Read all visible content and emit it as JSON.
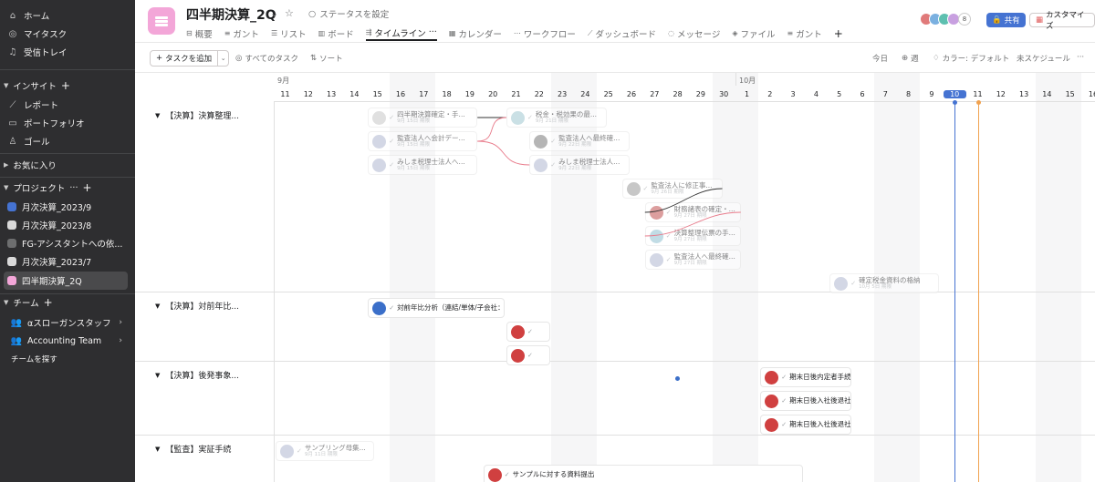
{
  "sidebar": {
    "nav": [
      {
        "label": "ホーム",
        "icon": "home-icon"
      },
      {
        "label": "マイタスク",
        "icon": "check-circle-icon"
      },
      {
        "label": "受信トレイ",
        "icon": "bell-icon"
      }
    ],
    "insight_label": "インサイト",
    "insights": [
      {
        "label": "レポート",
        "icon": "chart-line-icon"
      },
      {
        "label": "ポートフォリオ",
        "icon": "folder-icon"
      },
      {
        "label": "ゴール",
        "icon": "person-icon"
      }
    ],
    "favorites_label": "お気に入り",
    "projects_label": "プロジェクト",
    "projects": [
      {
        "label": "月次決算_2023/9",
        "color": "#4573d2"
      },
      {
        "label": "月次決算_2023/8",
        "color": "#d9d9d9"
      },
      {
        "label": "FG-アシスタントへの依...",
        "color": "#6d6e6f"
      },
      {
        "label": "月次決算_2023/7",
        "color": "#d9d9d9"
      },
      {
        "label": "四半期決算_2Q",
        "color": "#f3a6d8"
      }
    ],
    "teams_label": "チーム",
    "teams": [
      {
        "label": "αスローガンスタッフ"
      },
      {
        "label": "Accounting Team"
      }
    ],
    "find_team": "チームを探す"
  },
  "header": {
    "title": "四半期決算_2Q",
    "status": "ステータスを設定",
    "tabs": [
      {
        "label": "概要",
        "icon": "overview-icon"
      },
      {
        "label": "ガント",
        "icon": "gantt-icon"
      },
      {
        "label": "リスト",
        "icon": "list-icon"
      },
      {
        "label": "ボード",
        "icon": "board-icon"
      },
      {
        "label": "タイムライン",
        "icon": "timeline-icon",
        "active": true
      },
      {
        "label": "カレンダー",
        "icon": "calendar-icon"
      },
      {
        "label": "ワークフロー",
        "icon": "workflow-icon"
      },
      {
        "label": "ダッシュボード",
        "icon": "dashboard-icon"
      },
      {
        "label": "メッセージ",
        "icon": "message-icon"
      },
      {
        "label": "ファイル",
        "icon": "file-icon"
      },
      {
        "label": "ガント",
        "icon": "gantt-icon"
      }
    ],
    "member_count": "8",
    "share_label": "共有",
    "customize_label": "カスタマイズ"
  },
  "toolbar": {
    "add_task": "タスクを追加",
    "all_tasks": "すべてのタスク",
    "sort": "ソート",
    "today": "今日",
    "week": "週",
    "color": "カラー: デフォルト",
    "unscheduled": "未スケジュール"
  },
  "timeline": {
    "months": [
      {
        "label": "9月",
        "col": 0
      },
      {
        "label": "10月",
        "col": 20
      }
    ],
    "days": [
      "11",
      "12",
      "13",
      "14",
      "15",
      "16",
      "17",
      "18",
      "19",
      "20",
      "21",
      "22",
      "23",
      "24",
      "25",
      "26",
      "27",
      "28",
      "29",
      "30",
      "1",
      "2",
      "3",
      "4",
      "5",
      "6",
      "7",
      "8",
      "9",
      "10",
      "11",
      "12",
      "13",
      "14",
      "15",
      "16"
    ],
    "weekend_cols": [
      5,
      6,
      12,
      13,
      19,
      20,
      26,
      27,
      33,
      34
    ],
    "today_col": 29,
    "marker_col": 30,
    "groups": [
      {
        "label": "【決算】決算整理...",
        "tasks": [
          {
            "name": "四半期決算確定・手...",
            "date": "9月 15日 期限",
            "col": 4,
            "row": 0,
            "width": 120,
            "color": "#c8c8c8",
            "faded": true
          },
          {
            "name": "監査法人へ会計デー...",
            "date": "9月 15日 期限",
            "col": 4,
            "row": 1,
            "width": 120,
            "color": "#b0b8d0",
            "faded": true
          },
          {
            "name": "みしま税理士法人へ...",
            "date": "9月 15日 期限",
            "col": 4,
            "row": 2,
            "width": 120,
            "color": "#b0b8d0",
            "faded": true
          },
          {
            "name": "税金・税効果の最...",
            "date": "9月 21日 期限",
            "col": 10,
            "row": 0,
            "width": 110,
            "color": "#a0c8d0",
            "faded": true
          },
          {
            "name": "監査法人へ最終確...",
            "date": "9月 22日 期限",
            "col": 11,
            "row": 1,
            "width": 110,
            "color": "#7a7a7a",
            "faded": true
          },
          {
            "name": "みしま税理士法人...",
            "date": "9月 22日 期限",
            "col": 11,
            "row": 2,
            "width": 110,
            "color": "#b0b8d0",
            "faded": true
          },
          {
            "name": "監査法人に修正事...",
            "date": "9月 26日 期限",
            "col": 15,
            "row": 3,
            "width": 110,
            "color": "#9a9a9a",
            "faded": true
          },
          {
            "name": "財務諸表の確定・...",
            "date": "9月 27日 期限",
            "col": 16,
            "row": 4,
            "width": 105,
            "color": "#c05050",
            "faded": true
          },
          {
            "name": "決算整理伝票の手...",
            "date": "9月 27日 期限",
            "col": 16,
            "row": 5,
            "width": 105,
            "color": "#90c0d0",
            "faded": true
          },
          {
            "name": "監査法人へ最終確...",
            "date": "9月 27日 期限",
            "col": 16,
            "row": 6,
            "width": 105,
            "color": "#b0b8d0",
            "faded": true
          },
          {
            "name": "確定税金資料の格納",
            "date": "10月 5日 期限",
            "col": 24,
            "row": 7,
            "width": 120,
            "color": "#b0b8d0",
            "faded": true
          }
        ]
      },
      {
        "label": "【決算】対前年比...",
        "tasks": [
          {
            "name": "対前年比分析（連結/単体/子会社：税金計上前",
            "date": "",
            "col": 4,
            "row": 0,
            "width": 150,
            "color": "#3b6fc9",
            "faded": false
          },
          {
            "name": "",
            "date": "",
            "col": 10,
            "row": 1,
            "width": 48,
            "color": "#d04040",
            "faded": false
          },
          {
            "name": "",
            "date": "",
            "col": 10,
            "row": 2,
            "width": 48,
            "color": "#d04040",
            "faded": false
          }
        ]
      },
      {
        "label": "【決算】後発事象...",
        "tasks": [
          {
            "name": "期末日後内定者手続後評価...",
            "date": "",
            "col": 21,
            "row": 0,
            "width": 100,
            "color": "#d04040",
            "faded": false
          },
          {
            "name": "期末日後入社後退社返金...",
            "date": "",
            "col": 21,
            "row": 1,
            "width": 100,
            "color": "#d04040",
            "faded": false
          },
          {
            "name": "期末日後入社後退社返金...",
            "date": "",
            "col": 21,
            "row": 2,
            "width": 100,
            "color": "#d04040",
            "faded": false
          }
        ]
      },
      {
        "label": "【監査】実証手続",
        "tasks": [
          {
            "name": "サンプリング母集...",
            "date": "9月 11日 期限",
            "col": 0,
            "row": 0,
            "width": 108,
            "color": "#b0b8d0",
            "faded": true
          },
          {
            "name": "サンプルに対する資料提出",
            "date": "",
            "col": 9,
            "row": 1,
            "width": 350,
            "color": "#d04040",
            "faded": false
          }
        ]
      }
    ]
  }
}
